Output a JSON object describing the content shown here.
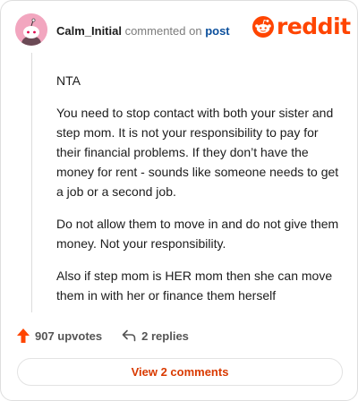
{
  "comment": {
    "username": "Calm_Initial",
    "action_text": " commented on ",
    "post_link_text": "post",
    "paragraphs": [
      "NTA",
      "You need to stop contact with both your sister and step mom. It is not your responsibility to pay for their financial problems. If they don’t have the money for rent - sounds like someone needs to get a job or a second job.",
      "Do not allow them to move in and do not give them money. Not your responsibility.",
      "Also if step mom is HER mom then she can move them in with her or finance them herself"
    ]
  },
  "brand": {
    "wordmark": "reddit",
    "color": "#ff4500"
  },
  "stats": {
    "upvotes_label": "907 upvotes",
    "replies_label": "2 replies"
  },
  "view_button": {
    "label": "View 2 comments"
  },
  "icons": {
    "avatar": "snoo-avatar",
    "logo": "reddit-snoo-icon",
    "upvote": "upvote-arrow-icon",
    "reply": "reply-arrow-icon"
  }
}
